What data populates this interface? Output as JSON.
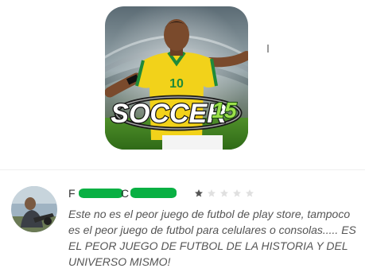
{
  "app_icon": {
    "logo_text": "SOCCER",
    "logo_number": "15",
    "jersey_number": "10"
  },
  "review": {
    "reviewer_initial_first": "F",
    "reviewer_initial_second": "C",
    "rating": {
      "filled": 1,
      "total": 5,
      "filled_color": "#555555",
      "empty_color": "#e0e0e0"
    },
    "text": "Este no es el peor juego de futbol de play store, tampoco es el peor juego de futbol para celulares o consolas..... ES EL PEOR JUEGO DE FUTBOL DE LA HISTORIA Y DEL UNIVERSO MISMO!"
  },
  "colors": {
    "redaction": "#09b043",
    "jersey_yellow": "#f2d21a",
    "jersey_green": "#1f8a3a",
    "text": "#555555"
  }
}
